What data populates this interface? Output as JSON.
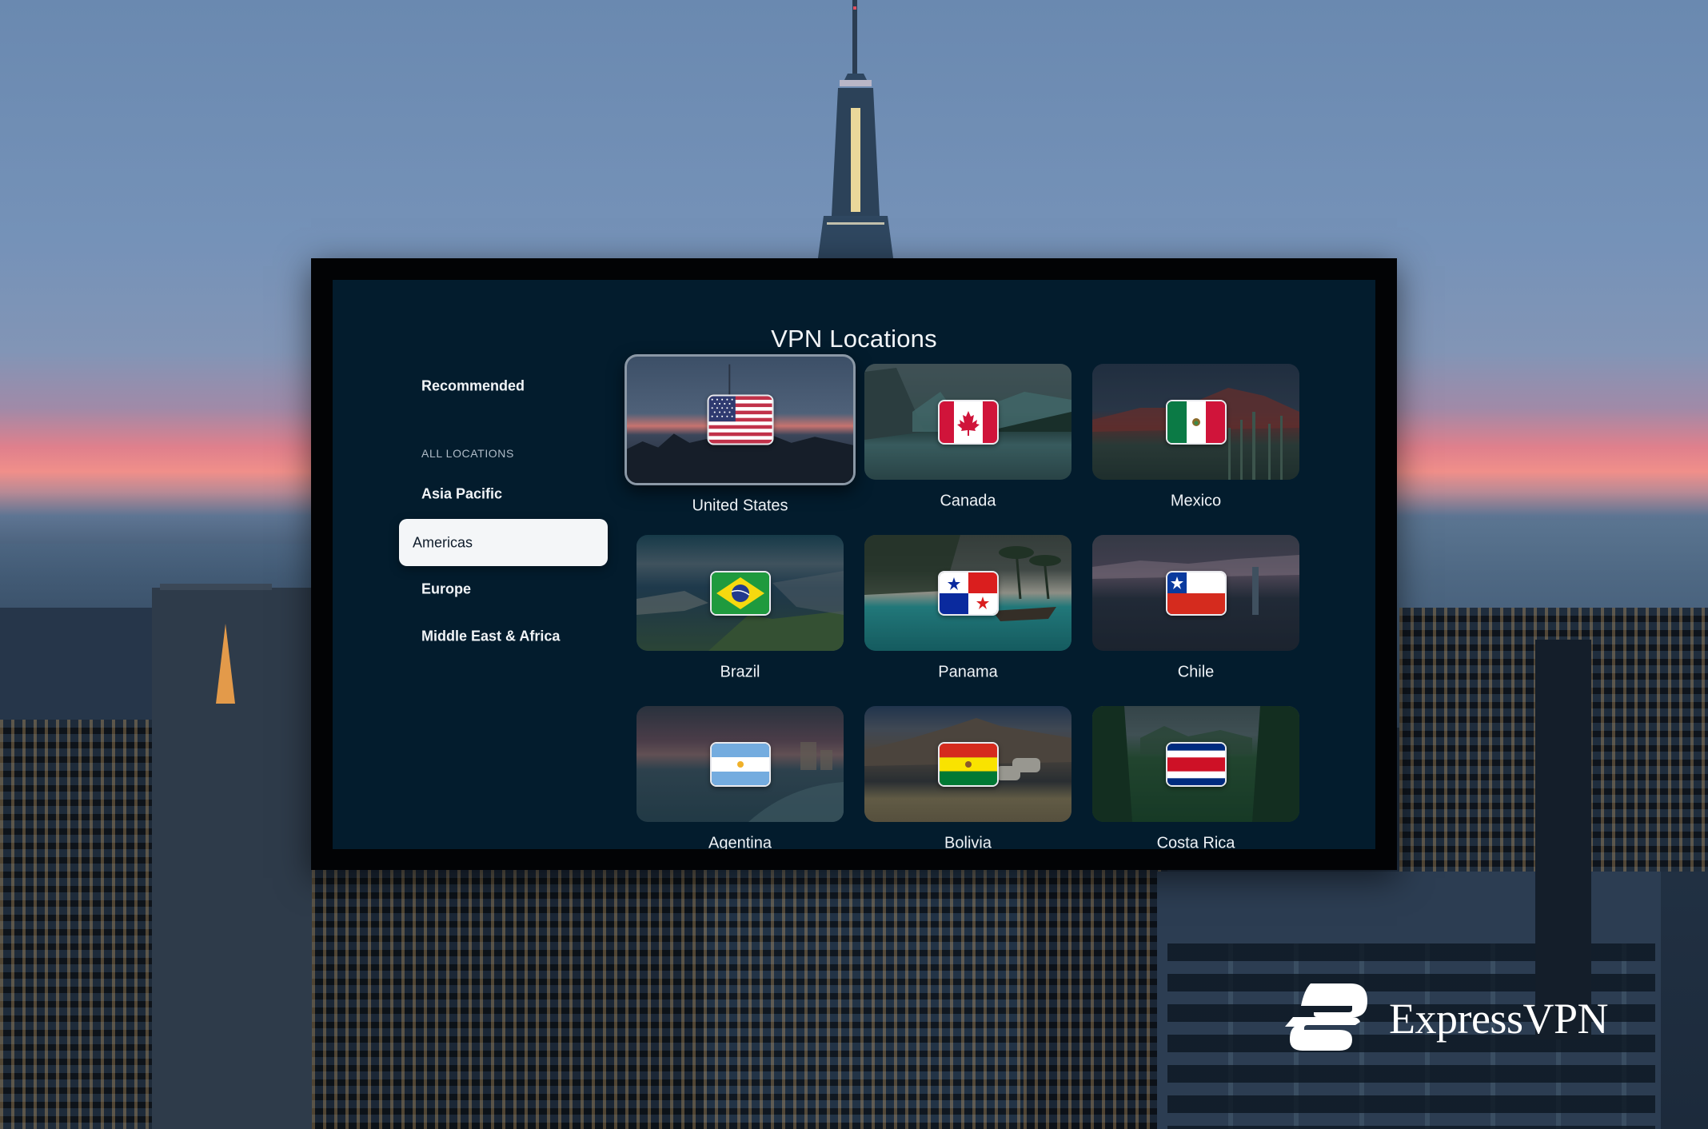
{
  "screen": {
    "title": "VPN Locations"
  },
  "sidebar": {
    "recommended": "Recommended",
    "section_heading": "ALL LOCATIONS",
    "items": [
      {
        "label": "Asia Pacific",
        "selected": false
      },
      {
        "label": "Americas",
        "selected": true
      },
      {
        "label": "Europe",
        "selected": false
      },
      {
        "label": "Middle East & Africa",
        "selected": false
      }
    ]
  },
  "locations": [
    {
      "name": "United States",
      "flag": "us-flag",
      "focused": true,
      "scene": "city-skyline"
    },
    {
      "name": "Canada",
      "flag": "canada-flag",
      "focused": false,
      "scene": "mountain-lake"
    },
    {
      "name": "Mexico",
      "flag": "mexico-flag",
      "focused": false,
      "scene": "volcano-cactus"
    },
    {
      "name": "Brazil",
      "flag": "brazil-flag",
      "focused": false,
      "scene": "rio-coast"
    },
    {
      "name": "Panama",
      "flag": "panama-flag",
      "focused": false,
      "scene": "tropical-beach"
    },
    {
      "name": "Chile",
      "flag": "chile-flag",
      "focused": false,
      "scene": "santiago-city"
    },
    {
      "name": "Agentina",
      "flag": "argentina-flag",
      "focused": false,
      "scene": "sunset-beach"
    },
    {
      "name": "Bolivia",
      "flag": "bolivia-flag",
      "focused": false,
      "scene": "altiplano-llamas"
    },
    {
      "name": "Costa Rica",
      "flag": "costa-rica-flag",
      "focused": false,
      "scene": "rainforest"
    }
  ],
  "brand": {
    "name": "ExpressVPN",
    "logo_icon": "expressvpn-logo-icon"
  },
  "colors": {
    "screen_bg": "#031c2d",
    "pill_bg": "#f4f6f8",
    "pill_text": "#0f1c2b",
    "text_primary": "#eef2f6",
    "text_muted": "#b0bcc8"
  }
}
